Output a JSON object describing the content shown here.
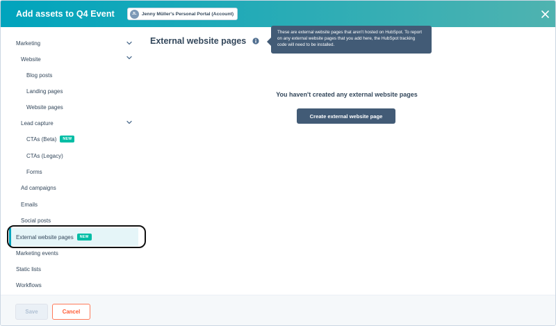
{
  "header": {
    "title": "Add assets to Q4 Event",
    "account": {
      "initials": "JL",
      "label": "Jenny Müller's Personal Portal (Account)"
    },
    "close_icon": "close-icon"
  },
  "sidebar": {
    "items": [
      {
        "label": "Marketing",
        "chevron": true
      },
      {
        "label": "Website",
        "chevron": true
      },
      {
        "label": "Blog posts"
      },
      {
        "label": "Landing pages"
      },
      {
        "label": "Website pages"
      },
      {
        "label": "Lead capture",
        "chevron": true
      },
      {
        "label": "CTAs (Beta)",
        "badge": "NEW"
      },
      {
        "label": "CTAs (Legacy)"
      },
      {
        "label": "Forms"
      },
      {
        "label": "Ad campaigns"
      },
      {
        "label": "Emails"
      },
      {
        "label": "Social posts"
      },
      {
        "label": "External website pages",
        "badge": "NEW",
        "active": true
      },
      {
        "label": "Marketing events"
      },
      {
        "label": "Static lists"
      },
      {
        "label": "Workflows"
      }
    ]
  },
  "main": {
    "title": "External website pages",
    "tooltip": "These are external website pages that aren't hosted on HubSpot. To report on any external website pages that you add here, the HubSpot tracking code will need to be installed.",
    "empty_message": "You haven't created any external website pages",
    "create_button": "Create external website page"
  },
  "footer": {
    "save_label": "Save",
    "cancel_label": "Cancel"
  },
  "colors": {
    "header_gradient_start": "#00a4bd",
    "header_gradient_end": "#4fb3b0",
    "primary_dark": "#425b76",
    "new_badge": "#00bda5",
    "cancel_accent": "#ff7a59",
    "active_bg": "#e5f5f8"
  }
}
